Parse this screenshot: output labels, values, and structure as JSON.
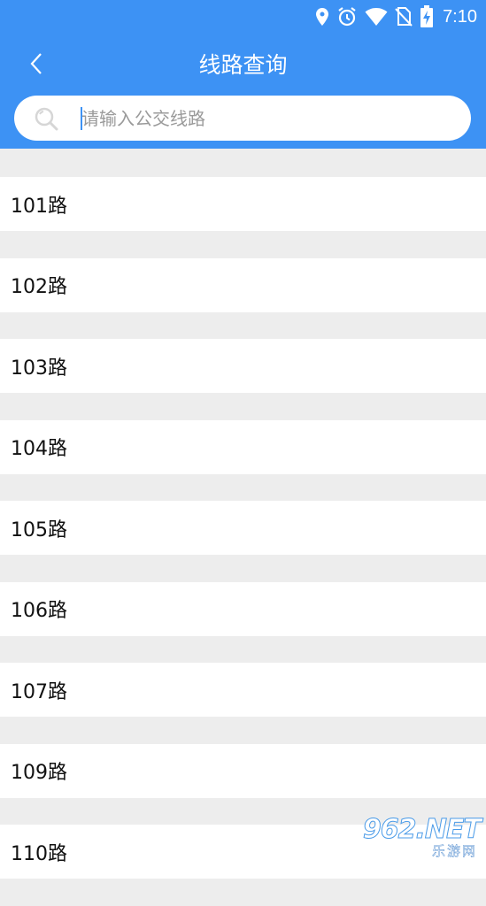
{
  "status_bar": {
    "time": "7:10",
    "icons": [
      "location-icon",
      "alarm-icon",
      "wifi-icon",
      "no-sim-icon",
      "battery-charging-icon"
    ]
  },
  "header": {
    "title": "线路查询",
    "back_icon": "chevron-left-icon"
  },
  "search": {
    "placeholder": "请输入公交线路",
    "value": ""
  },
  "routes": [
    "101路",
    "102路",
    "103路",
    "104路",
    "105路",
    "106路",
    "107路",
    "109路",
    "110路"
  ],
  "watermark": {
    "main": "962.NET",
    "sub": "乐游网"
  },
  "colors": {
    "accent": "#3d92f4",
    "background": "#ededed",
    "item_background": "#ffffff"
  }
}
